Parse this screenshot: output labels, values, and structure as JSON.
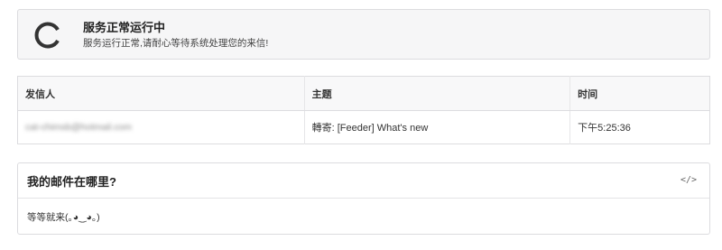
{
  "status": {
    "title": "服务正常运行中",
    "subtitle": "服务运行正常,请耐心等待系统处理您的来信!",
    "icon": "loading-spinner-icon"
  },
  "table": {
    "headers": [
      "发信人",
      "主题",
      "时间"
    ],
    "rows": [
      {
        "sender": "cat-chimsb@hotmail.com",
        "subject": "轉寄: [Feeder] What's new",
        "time": "下午5:25:36"
      }
    ]
  },
  "faq": {
    "title": "我的邮件在哪里?",
    "body": "等等就来(｡◕‿◕｡)",
    "code_icon": "</>"
  },
  "colors": {
    "border": "#dcdcdf",
    "status_bg": "#f6f6f7",
    "spinner": "#333333"
  }
}
